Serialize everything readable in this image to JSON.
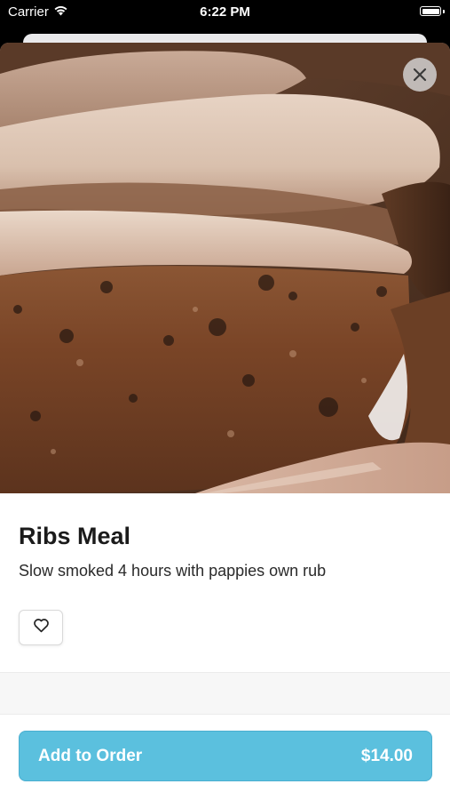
{
  "status_bar": {
    "carrier": "Carrier",
    "time": "6:22 PM",
    "wifi_icon": "wifi-icon",
    "battery_icon": "battery-icon"
  },
  "hero": {
    "image": "smoked-meat-slices-photo",
    "close_icon": "close-icon"
  },
  "item": {
    "title": "Ribs Meal",
    "description": "Slow smoked 4 hours with pappies own rub",
    "favorite_icon": "heart-outline-icon"
  },
  "order_button": {
    "label": "Add to Order",
    "price": "$14.00",
    "color": "#5bc0de"
  }
}
